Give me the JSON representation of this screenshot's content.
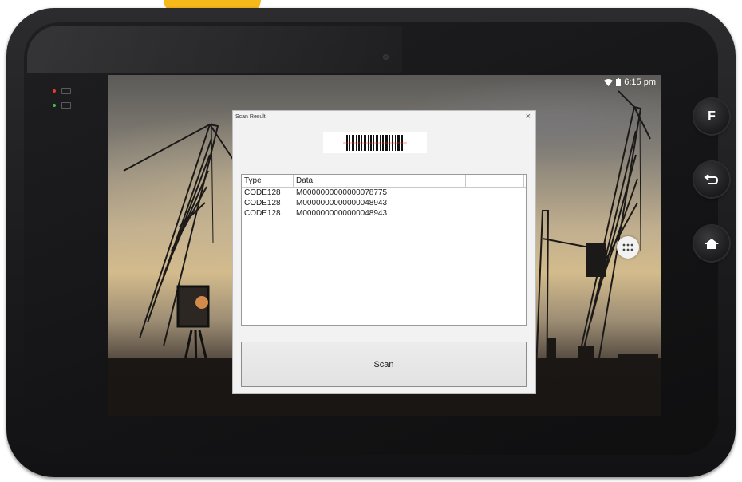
{
  "status_bar": {
    "time": "6:15 pm",
    "wifi_icon": "wifi-icon",
    "battery_icon": "battery-icon"
  },
  "hardware_buttons": [
    {
      "name": "f-button",
      "label": "F"
    },
    {
      "name": "back-button",
      "icon": "back-arrow-icon"
    },
    {
      "name": "home-button",
      "icon": "home-icon"
    }
  ],
  "dialog": {
    "title": "Scan Result",
    "close_label": "×",
    "columns": [
      "Type",
      "Data"
    ],
    "rows": [
      {
        "type": "CODE128",
        "data": "M0000000000000078775"
      },
      {
        "type": "CODE128",
        "data": "M0000000000000048943"
      },
      {
        "type": "CODE128",
        "data": "M0000000000000048943"
      }
    ],
    "scan_button_label": "Scan"
  },
  "colors": {
    "accent_yellow": "#f6b91a",
    "dialog_bg": "#f2f2f2"
  }
}
